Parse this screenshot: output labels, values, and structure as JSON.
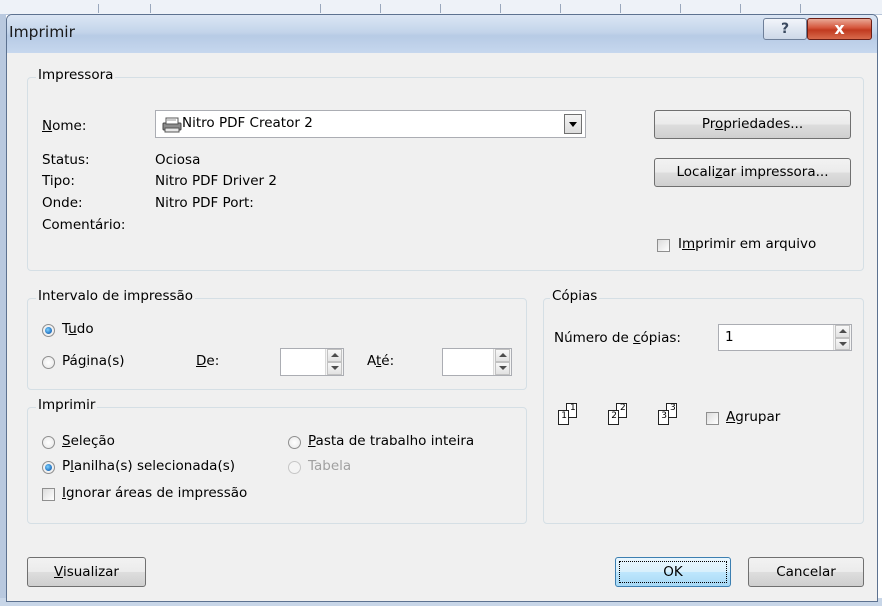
{
  "dialog": {
    "title": "Imprimir",
    "help_glyph": "?",
    "close_glyph": "x"
  },
  "printer": {
    "legend": "Impressora",
    "name_label_u": "N",
    "name_label_rest": "ome:",
    "name_value": "Nitro PDF Creator 2",
    "status_label": "Status:",
    "status_value": "Ociosa",
    "type_label": "Tipo:",
    "type_value": "Nitro PDF Driver 2",
    "where_label": "Onde:",
    "where_value": "Nitro PDF Port:",
    "comment_label": "Comentário:",
    "properties_pre": "Pr",
    "properties_u": "o",
    "properties_post": "priedades...",
    "find_pre": "Locali",
    "find_u": "z",
    "find_post": "ar impressora...",
    "print_to_file_pre": "I",
    "print_to_file_u": "m",
    "print_to_file_post": "primir em arquivo",
    "print_to_file_checked": false
  },
  "range": {
    "legend": "Intervalo de impressão",
    "all_pre": "T",
    "all_u": "u",
    "all_post": "do",
    "all_selected": true,
    "pages_pre": "Pá",
    "pages_u": "g",
    "pages_post": "ina(s)",
    "from_u": "D",
    "from_post": "e:",
    "to_pre": "A",
    "to_u": "t",
    "to_post": "é:",
    "from_value": "",
    "to_value": ""
  },
  "print_what": {
    "legend": "Imprimir",
    "selection_u": "S",
    "selection_post": "eleção",
    "workbook_u": "P",
    "workbook_post": "asta de trabalho inteira",
    "sheets_pre": "P",
    "sheets_u": "l",
    "sheets_post": "anilha(s) selecionada(s)",
    "sheets_selected": true,
    "table": "Tabela",
    "ignore_u": "I",
    "ignore_post": "gnorar áreas de impressão",
    "ignore_checked": false
  },
  "copies": {
    "legend": "Cópias",
    "count_pre": "Número de ",
    "count_u": "c",
    "count_post": "ópias:",
    "count_value": "1",
    "collate_u": "A",
    "collate_post": "grupar",
    "collate_checked": false,
    "collate_pages": [
      "1",
      "2",
      "3"
    ]
  },
  "footer": {
    "preview_u": "V",
    "preview_post": "isualizar",
    "ok": "OK",
    "cancel": "Cancelar"
  }
}
